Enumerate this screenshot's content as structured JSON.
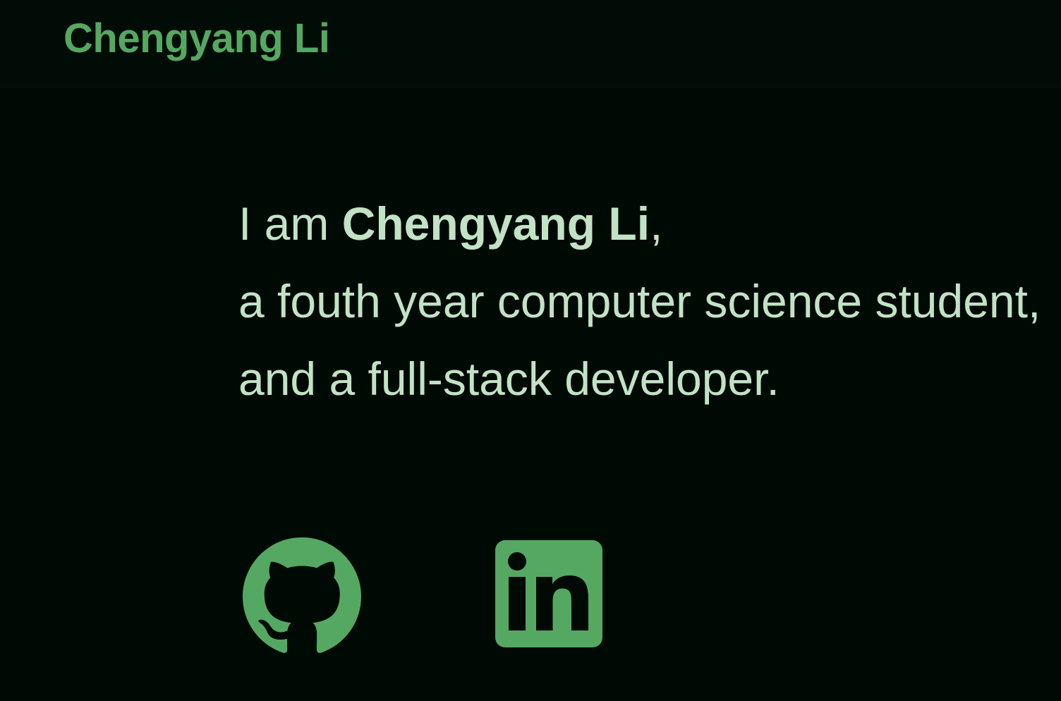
{
  "header": {
    "brand": "Chengyang Li"
  },
  "intro": {
    "prefix": "I am ",
    "name": "Chengyang Li",
    "comma": ",",
    "line2": "a fouth year computer science student,",
    "line3": "and a full-stack developer."
  },
  "social": [
    {
      "icon": "github-icon"
    },
    {
      "icon": "linkedin-icon"
    }
  ],
  "colors": {
    "background": "#000a05",
    "accent": "#55a861",
    "text": "#c2e2c5"
  }
}
